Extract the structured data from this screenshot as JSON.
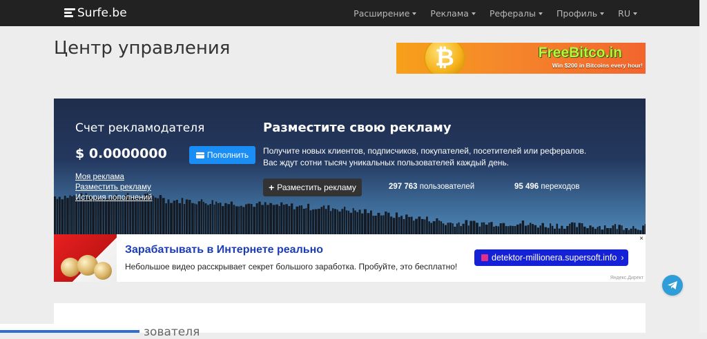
{
  "navbar": {
    "logo": "Surfe.be",
    "items": [
      {
        "label": "Расширение"
      },
      {
        "label": "Реклама"
      },
      {
        "label": "Рефералы"
      },
      {
        "label": "Профиль"
      },
      {
        "label": "RU"
      }
    ]
  },
  "page": {
    "title": "Центр управления"
  },
  "promo_banner": {
    "brand": "FreeBitco.in",
    "tagline": "Win $200 in Bitcoins every hour!",
    "coin_symbol": "₿"
  },
  "account": {
    "title": "Счет рекламодателя",
    "balance": "$ 0.0000000",
    "topup_label": "Пополнить",
    "links": [
      {
        "label": "Моя реклама"
      },
      {
        "label": "Разместить рекламу"
      },
      {
        "label": "История пополнений"
      }
    ]
  },
  "cta": {
    "title": "Разместите свою рекламу",
    "line1": "Получите новых клиентов, подписчиков, покупателей, посетителей или рефералов.",
    "line2": "Вас ждут сотни тысяч уникальных пользователей каждый день.",
    "button_label": "Разместить рекламу",
    "users_count": "297 763",
    "users_label": "пользователей",
    "clicks_count": "95 496",
    "clicks_label": "переходов"
  },
  "ad": {
    "headline": "Зарабатывать в Интернете реально",
    "text": "Небольшое видео расскрывает секрет большого заработка. Пробуйте, это бесплатно!",
    "link_label": "detektor-millionera.supersoft.info",
    "link_arrow": "›",
    "close": "×",
    "source": "Яндекс.Директ"
  },
  "bottom": {
    "heading_partial": "зователя"
  },
  "colors": {
    "navbar_bg": "#222222",
    "primary_button": "#1a8ef5",
    "ad_link_button": "#1421d6",
    "telegram": "#2f9ed8"
  }
}
